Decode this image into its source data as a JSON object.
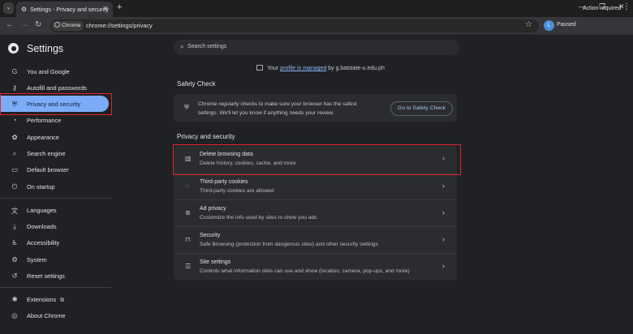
{
  "browser": {
    "tab_title": "Settings - Privacy and security",
    "tab_close": "✕",
    "new_tab": "+",
    "tab_search_glyph": "⌄",
    "omnibox_chip": "Chrome",
    "url": "chrome://settings/privacy",
    "profile_initial": "L",
    "profile_status": "Paused",
    "action_required": "Action required"
  },
  "header": {
    "title": "Settings",
    "search_placeholder": "Search settings"
  },
  "sidebar": {
    "items": [
      {
        "label": "You and Google",
        "icon": "google-icon",
        "glyph": "G"
      },
      {
        "label": "Autofill and passwords",
        "icon": "key-icon",
        "glyph": "⚷"
      },
      {
        "label": "Privacy and security",
        "icon": "shield-icon",
        "glyph": "⛨",
        "active": true
      },
      {
        "label": "Performance",
        "icon": "speedometer-icon",
        "glyph": "◔"
      },
      {
        "label": "Appearance",
        "icon": "palette-icon",
        "glyph": "✿"
      },
      {
        "label": "Search engine",
        "icon": "search-icon",
        "glyph": "⌕"
      },
      {
        "label": "Default browser",
        "icon": "browser-icon",
        "glyph": "▭"
      },
      {
        "label": "On startup",
        "icon": "power-icon",
        "glyph": "⏻"
      },
      {
        "label": "Languages",
        "icon": "translate-icon",
        "glyph": "文"
      },
      {
        "label": "Downloads",
        "icon": "download-icon",
        "glyph": "⤓"
      },
      {
        "label": "Accessibility",
        "icon": "accessibility-icon",
        "glyph": "♿"
      },
      {
        "label": "System",
        "icon": "wrench-icon",
        "glyph": "⚙"
      },
      {
        "label": "Reset settings",
        "icon": "reset-icon",
        "glyph": "↺"
      },
      {
        "label": "Extensions",
        "icon": "puzzle-icon",
        "glyph": "✱",
        "external": "⧉"
      },
      {
        "label": "About Chrome",
        "icon": "chrome-icon",
        "glyph": "◎"
      }
    ]
  },
  "managed": {
    "prefix": "Your ",
    "link": "profile is managed",
    "suffix": " by g.batstate-u.edu.ph"
  },
  "safety_check": {
    "heading": "Safety Check",
    "text": "Chrome regularly checks to make sure your browser has the safest settings. We'll let you know if anything needs your review.",
    "button": "Go to Safety Check"
  },
  "privacy": {
    "heading": "Privacy and security",
    "rows": [
      {
        "title": "Delete browsing data",
        "subtitle": "Delete history, cookies, cache, and more",
        "icon": "trash-icon",
        "glyph": "🗑"
      },
      {
        "title": "Third-party cookies",
        "subtitle": "Third-party cookies are allowed",
        "icon": "cookie-icon",
        "glyph": "◌"
      },
      {
        "title": "Ad privacy",
        "subtitle": "Customize the info used by sites to show you ads",
        "icon": "ad-privacy-icon",
        "glyph": "⊛"
      },
      {
        "title": "Security",
        "subtitle": "Safe Browsing (protection from dangerous sites) and other security settings",
        "icon": "lock-icon",
        "glyph": "🔒"
      },
      {
        "title": "Site settings",
        "subtitle": "Controls what information sites can use and show (location, camera, pop-ups, and more)",
        "icon": "sliders-icon",
        "glyph": "☰"
      }
    ]
  },
  "colors": {
    "accent": "#7cacf8",
    "highlight_box": "#e0262e",
    "link": "#8ab4f8"
  }
}
